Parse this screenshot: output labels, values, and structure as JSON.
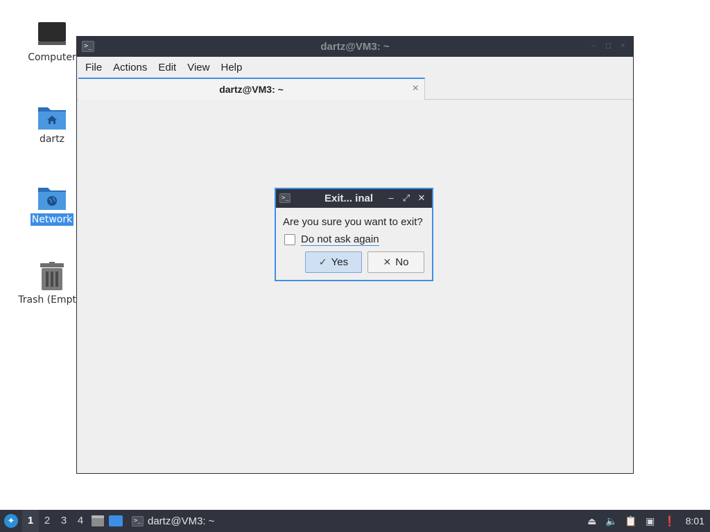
{
  "desktop": {
    "icons": [
      {
        "label": "Computer",
        "icon": "computer-icon"
      },
      {
        "label": "dartz",
        "icon": "home-folder-icon"
      },
      {
        "label": "Network",
        "icon": "network-folder-icon",
        "selected": true
      },
      {
        "label": "Trash (Empty)",
        "icon": "trash-icon"
      }
    ]
  },
  "terminal": {
    "window_title": "dartz@VM3: ~",
    "menu": [
      "File",
      "Actions",
      "Edit",
      "View",
      "Help"
    ],
    "tab_title": "dartz@VM3: ~",
    "tab_close": "×"
  },
  "dialog": {
    "title": "Exit... inal",
    "question": "Are you sure you want to exit?",
    "checkbox_label": "Do not ask again",
    "checkbox_checked": false,
    "yes_label": "Yes",
    "no_label": "No"
  },
  "taskbar": {
    "workspaces": [
      "1",
      "2",
      "3",
      "4"
    ],
    "active_workspace": "1",
    "task_label": "dartz@VM3: ~",
    "clock": "8:01"
  },
  "colors": {
    "titlebar": "#2f343f",
    "accent": "#3d8ee6",
    "window_bg": "#efefef"
  }
}
